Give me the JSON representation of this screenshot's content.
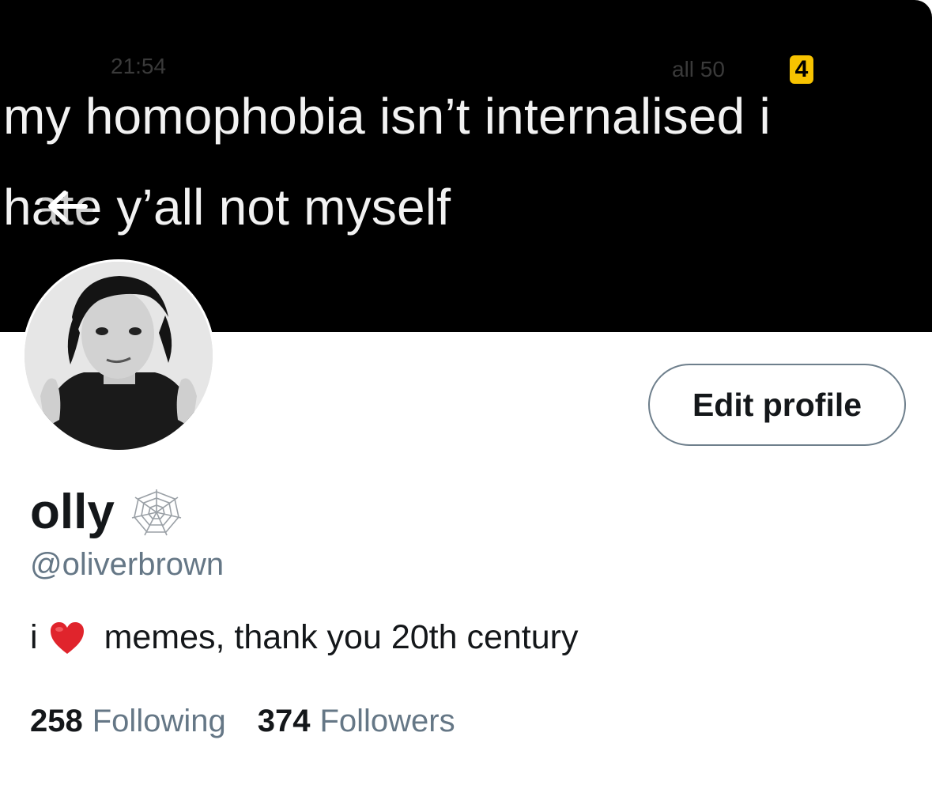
{
  "banner": {
    "line1": "my homophobia isn’t internalised i",
    "line2": "hate y’all not myself",
    "ghost_time": "21:54",
    "ghost_status": "all 50",
    "battery": "4"
  },
  "profile": {
    "display_name": "olly",
    "handle": "@oliverbrown",
    "bio_prefix": "i",
    "bio_text": "memes, thank you 20th century",
    "edit_button": "Edit profile"
  },
  "stats": {
    "following_count": "258",
    "following_label": "Following",
    "followers_count": "374",
    "followers_label": "Followers"
  },
  "icons": {
    "back": "arrow-left-icon",
    "name_emoji": "spider-web-icon",
    "bio_emoji": "heart-icon"
  },
  "colors": {
    "primary_text": "#14171a",
    "secondary_text": "#657786",
    "button_border": "#6e7f8c",
    "banner_bg": "#000000",
    "heart": "#e0242c"
  }
}
